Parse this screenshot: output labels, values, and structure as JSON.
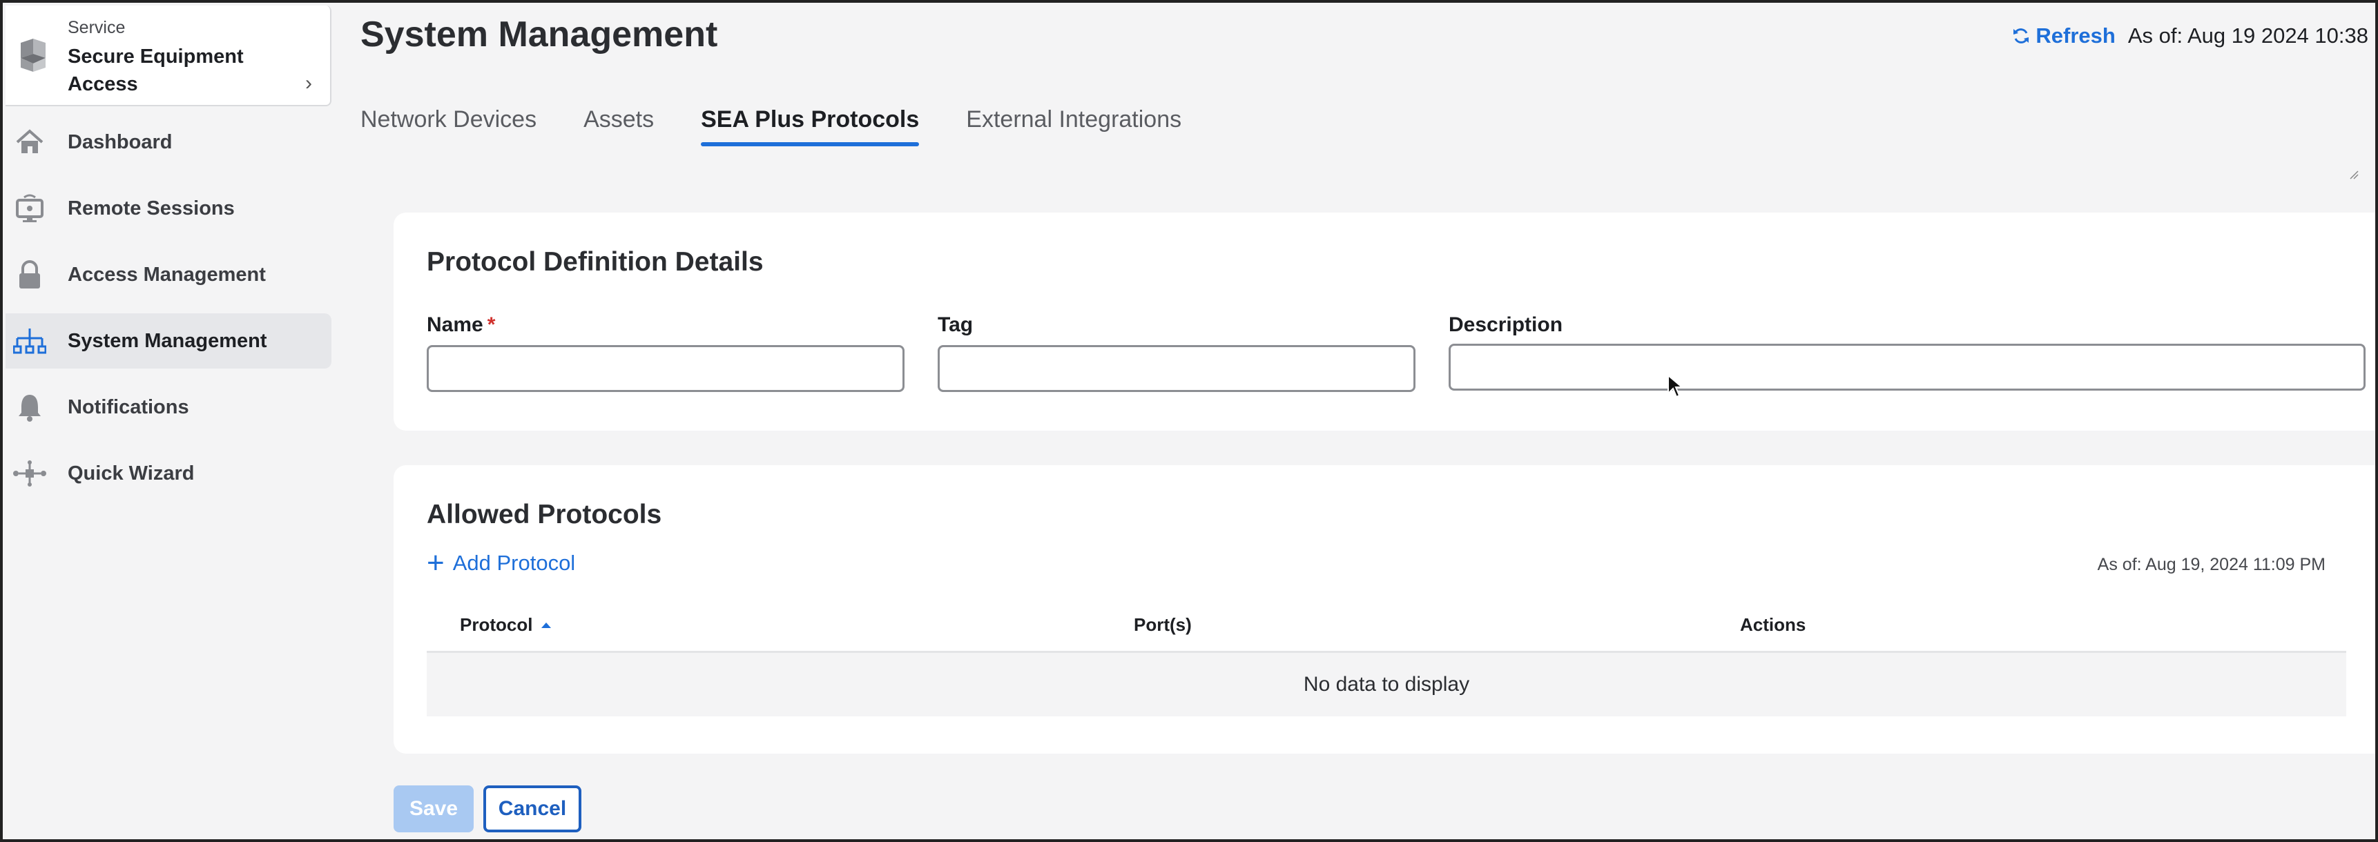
{
  "sidebar": {
    "service_label": "Service",
    "service_name": "Secure Equipment Access",
    "items": [
      {
        "label": "Dashboard",
        "icon": "home-icon"
      },
      {
        "label": "Remote Sessions",
        "icon": "remote-monitor-icon"
      },
      {
        "label": "Access Management",
        "icon": "lock-icon"
      },
      {
        "label": "System Management",
        "icon": "network-tree-icon",
        "active": true
      },
      {
        "label": "Notifications",
        "icon": "bell-icon"
      },
      {
        "label": "Quick Wizard",
        "icon": "wizard-flow-icon"
      }
    ]
  },
  "header": {
    "title": "System Management",
    "refresh_label": "Refresh",
    "as_of": "As of: Aug 19 2024 10:38"
  },
  "tabs": [
    {
      "label": "Network Devices"
    },
    {
      "label": "Assets"
    },
    {
      "label": "SEA Plus Protocols",
      "active": true
    },
    {
      "label": "External Integrations"
    }
  ],
  "protocol_definition": {
    "title": "Protocol Definition Details",
    "name_label": "Name",
    "required_mark": "*",
    "tag_label": "Tag",
    "description_label": "Description",
    "name_value": "",
    "tag_value": "",
    "description_value": ""
  },
  "allowed_protocols": {
    "title": "Allowed Protocols",
    "add_label": "Add Protocol",
    "as_of": "As of: Aug 19, 2024 11:09 PM",
    "columns": [
      "Protocol",
      "Port(s)",
      "Actions"
    ],
    "empty_message": "No data to display"
  },
  "actions": {
    "save_label": "Save",
    "cancel_label": "Cancel"
  },
  "colors": {
    "accent": "#1e6fd9",
    "required": "#d0312d",
    "save_disabled": "#a9c9f2"
  }
}
